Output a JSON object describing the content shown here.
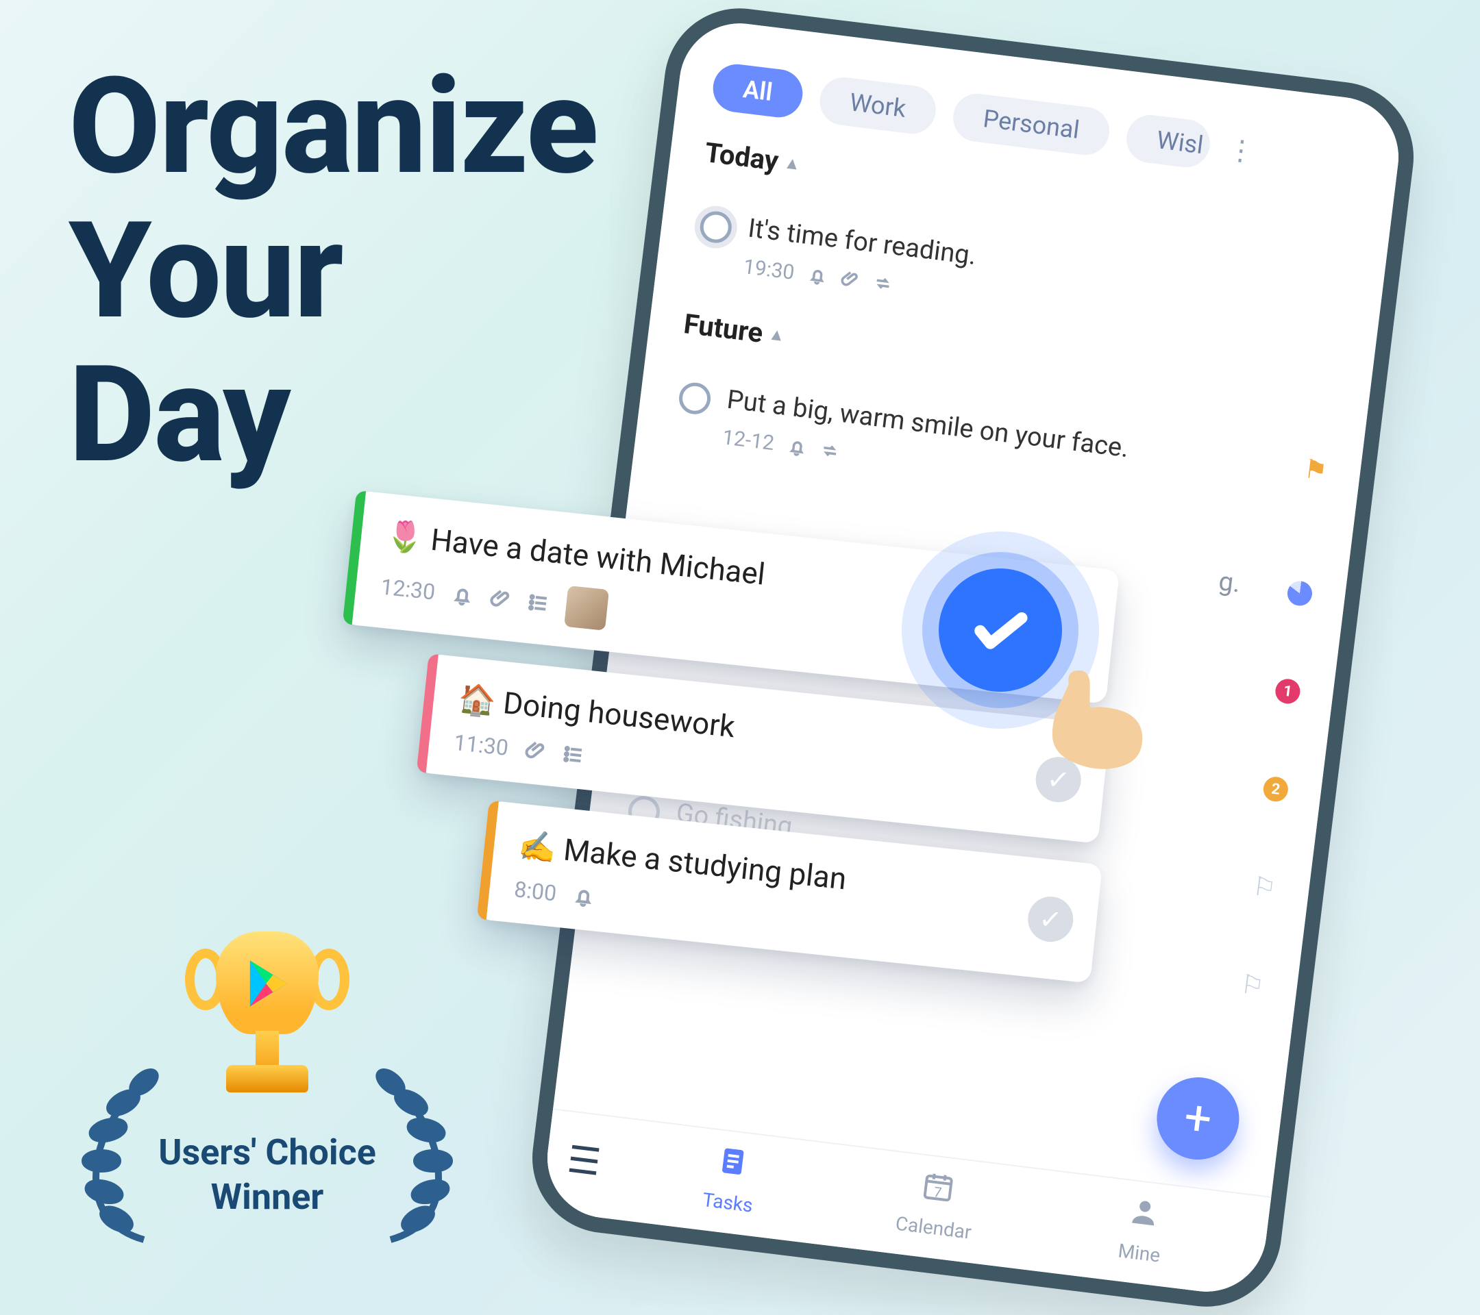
{
  "headline": {
    "line1": "Organize",
    "line2": "Your",
    "line3": "Day"
  },
  "award": {
    "caption_line1": "Users' Choice",
    "caption_line2": "Winner"
  },
  "chips": {
    "all": "All",
    "work": "Work",
    "personal": "Personal",
    "wish": "Wisl"
  },
  "sections": {
    "today": "Today",
    "future": "Future"
  },
  "tasks": {
    "today0": {
      "title": "It's time for reading.",
      "time": "19:30"
    },
    "future0": {
      "title": "Put a big, warm smile on your face.",
      "date": "12-12"
    },
    "future1_fragment": "g.",
    "future2_badge": "1",
    "future3_badge": "2",
    "future4_title": "Go fishing."
  },
  "cards": {
    "c1": {
      "emoji": "🌷",
      "title": "Have a date with Michael",
      "time": "12:30"
    },
    "c2": {
      "emoji": "🏠",
      "title": "Doing housework",
      "time": "11:30"
    },
    "c3": {
      "emoji": "✍️",
      "title": "Make a studying plan",
      "time": "8:00"
    }
  },
  "nav": {
    "tasks": "Tasks",
    "calendar": "Calendar",
    "mine": "Mine",
    "cal_day": "7"
  },
  "fab": "+"
}
